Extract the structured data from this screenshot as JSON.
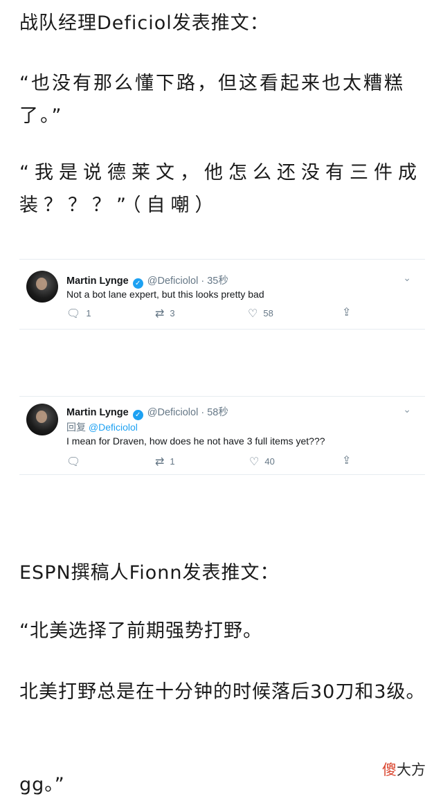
{
  "article": {
    "p1": "战队经理Deficiol发表推文：",
    "p2": "“也没有那么懂下路，但这看起来也太糟糕了。”",
    "p3": "“我是说德莱文，他怎么还没有三件成装？？？”（自嘲）",
    "p4": "ESPN撰稿人Fionn发表推文：",
    "p5": "“北美选择了前期强势打野。",
    "p6": "北美打野总是在十分钟的时候落后30刀和3级。",
    "p7": "gg。”"
  },
  "tweets": [
    {
      "name": "Martin Lynge",
      "handle": "@Deficiolol",
      "time": "· 35秒",
      "text": "Not a bot lane expert, but this looks pretty bad",
      "reply_count": "1",
      "retweet_count": "3",
      "like_count": "58"
    },
    {
      "name": "Martin Lynge",
      "handle": "@Deficiolol",
      "time": "· 58秒",
      "reply_prefix": "回复",
      "reply_to": "@Deficiolol",
      "text": "I mean for Draven, how does he not have 3 full items yet???",
      "reply_count": "",
      "retweet_count": "1",
      "like_count": "40"
    }
  ],
  "icons": {
    "reply": "speech-bubble",
    "retweet": "loop-arrows",
    "like": "heart",
    "share": "upload-arrow",
    "more": "chevron-down"
  },
  "watermark": {
    "part1": "傻",
    "part2": "大方"
  },
  "colors": {
    "twitter_blue": "#1da1f2",
    "meta_gray": "#657786",
    "watermark_red": "#d9432c"
  }
}
